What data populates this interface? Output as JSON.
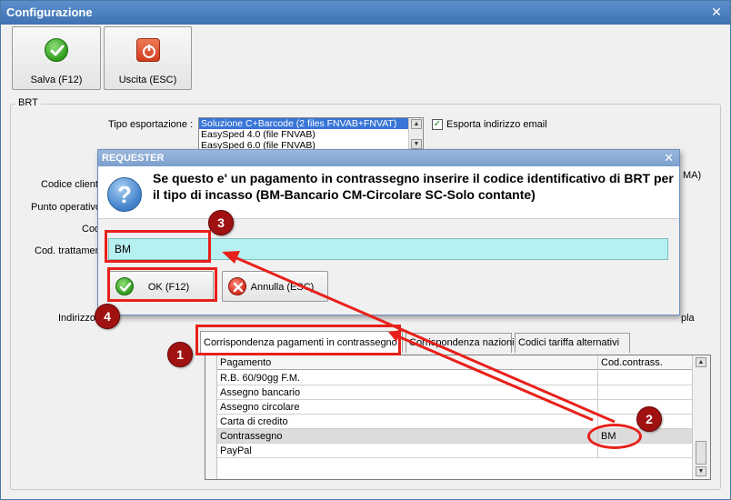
{
  "window": {
    "title": "Configurazione",
    "close_glyph": "✕"
  },
  "toolbar": {
    "save_label": "Salva (F12)",
    "exit_label": "Uscita (ESC)"
  },
  "group": {
    "title": "BRT",
    "tipo_esportazione_label": "Tipo esportazione :",
    "tipo_options": [
      "Soluzione C+Barcode (2 files FNVAB+FNVAT)",
      "EasySped 4.0 (file FNVAB)",
      "EasySped 6.0 (file FNVAB)"
    ],
    "esporta_email_label": "Esporta indirizzo email",
    "esporta_email_checked": true,
    "labels": {
      "codice_cliente": "Codice cliente",
      "punto_operativo": "Punto operativo",
      "cod": "Cod",
      "cod_trattamento": "Cod. trattamen",
      "indirizzo": "Indirizzo",
      "partial_ma": "MA)",
      "partial_pla": "pla"
    }
  },
  "tabs": [
    {
      "label": "Corrispondenza pagamenti in contrassegno",
      "active": true
    },
    {
      "label": "Corrispondenza nazioni",
      "active": false
    },
    {
      "label": "Codici tariffa alternativi",
      "active": false
    }
  ],
  "grid": {
    "headers": [
      "Pagamento",
      "Cod.contrass."
    ],
    "rows": [
      {
        "pagamento": "R.B. 60/90gg F.M.",
        "cod": ""
      },
      {
        "pagamento": "Assegno bancario",
        "cod": ""
      },
      {
        "pagamento": "Assegno circolare",
        "cod": ""
      },
      {
        "pagamento": "Carta di credito",
        "cod": ""
      },
      {
        "pagamento": "Contrassegno",
        "cod": "BM"
      },
      {
        "pagamento": "PayPal",
        "cod": ""
      }
    ],
    "selected_row": 4
  },
  "dialog": {
    "title": "REQUESTER",
    "close_glyph": "✕",
    "question_glyph": "?",
    "message": "Se questo e' un pagamento in contrassegno inserire il codice identificativo di BRT per il tipo di incasso (BM-Bancario  CM-Circolare  SC-Solo contante)",
    "input_value": "BM",
    "ok_label": "OK (F12)",
    "cancel_label": "Annulla (ESC)"
  },
  "annotations": {
    "badges": [
      "1",
      "2",
      "3",
      "4"
    ],
    "color": "#e8201a",
    "badge_color": "#a01212"
  },
  "colors": {
    "input_bg": "#b7f0f0",
    "titlebar": "#3f72b4",
    "selection": "#3875d7"
  }
}
